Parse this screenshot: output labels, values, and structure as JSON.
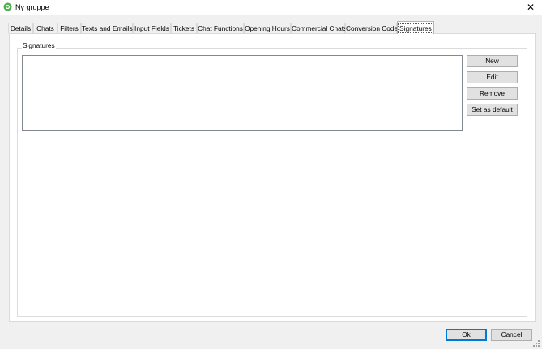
{
  "window": {
    "title": "Ny gruppe",
    "close_glyph": "✕"
  },
  "tabs": [
    {
      "label": "Details"
    },
    {
      "label": "Chats"
    },
    {
      "label": "Filters"
    },
    {
      "label": "Texts and Emails"
    },
    {
      "label": "Input Fields"
    },
    {
      "label": "Tickets"
    },
    {
      "label": "Chat Functions"
    },
    {
      "label": "Opening Hours"
    },
    {
      "label": "Commercial Chats"
    },
    {
      "label": "Conversion Code"
    },
    {
      "label": "Signatures",
      "active": true
    }
  ],
  "signatures": {
    "group_label": "Signatures",
    "items": [],
    "buttons": {
      "new": "New",
      "edit": "Edit",
      "remove": "Remove",
      "set_default": "Set as default"
    }
  },
  "footer": {
    "ok": "Ok",
    "cancel": "Cancel"
  },
  "colors": {
    "app_icon": "#4caf50",
    "primary_border": "#0078d7"
  },
  "icons": {
    "app": "app-logo-icon",
    "close": "close-icon",
    "grip": "resize-grip-icon"
  }
}
